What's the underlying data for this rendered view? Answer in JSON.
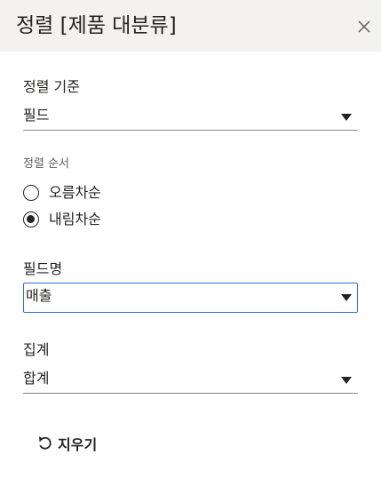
{
  "panel": {
    "title": "정렬 [제품 대분류]"
  },
  "sort_basis": {
    "label": "정렬 기준",
    "value": "필드"
  },
  "sort_order": {
    "label": "정렬 순서",
    "options": [
      {
        "label": "오름차순",
        "selected": false
      },
      {
        "label": "내림차순",
        "selected": true
      }
    ]
  },
  "field_name": {
    "label": "필드명",
    "value": "매출"
  },
  "aggregation": {
    "label": "집계",
    "value": "합계"
  },
  "actions": {
    "clear_label": "지우기"
  },
  "colors": {
    "header_bg": "#f3f2f1",
    "focus_border": "#2a6fdb",
    "text": "#252423"
  },
  "icons": [
    "close-icon",
    "caret-down-icon",
    "undo-icon"
  ]
}
